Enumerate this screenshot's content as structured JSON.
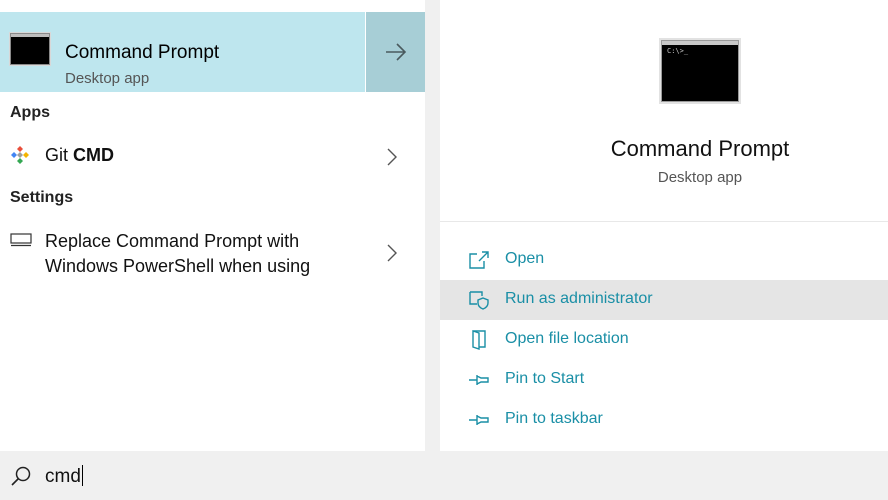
{
  "best_match": {
    "title": "Command Prompt",
    "subtitle": "Desktop app",
    "icon": "command-prompt-icon"
  },
  "sections": {
    "apps_header": "Apps",
    "settings_header": "Settings"
  },
  "apps": [
    {
      "label_prefix": "Git ",
      "label_bold": "CMD",
      "icon": "git-icon"
    }
  ],
  "settings": [
    {
      "line1": "Replace Command Prompt with",
      "line2": "Windows PowerShell when using",
      "icon": "display-settings-icon"
    }
  ],
  "detail": {
    "title": "Command Prompt",
    "subtitle": "Desktop app",
    "actions": [
      {
        "label": "Open",
        "icon": "open-icon"
      },
      {
        "label": "Run as administrator",
        "icon": "shield-icon"
      },
      {
        "label": "Open file location",
        "icon": "file-location-icon"
      },
      {
        "label": "Pin to Start",
        "icon": "pin-icon"
      },
      {
        "label": "Pin to taskbar",
        "icon": "pin-icon"
      }
    ]
  },
  "search": {
    "query": "cmd",
    "icon": "search-icon"
  },
  "colors": {
    "selected_bg": "#bee6ee",
    "selected_arrow_bg": "#a7ced6",
    "accent": "#1a8fa6",
    "hover_bg": "#e5e5e5"
  }
}
